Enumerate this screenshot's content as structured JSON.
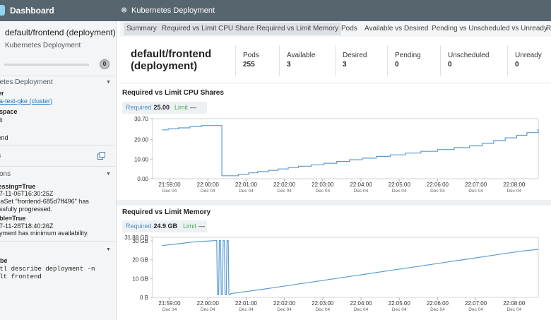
{
  "topbar": {
    "app_title": "Dashboard",
    "tab_icon": "cluster-gear-icon",
    "tab_title": "Kubernetes Deployment"
  },
  "left": {
    "title": "default/frontend (deployment)",
    "subtitle": "Kubernetes Deployment",
    "badge": "0",
    "sections": {
      "deployment": "netes Deployment",
      "details": "ls",
      "conditions": "tions",
      "cli": "l"
    },
    "cluster_key": "ter",
    "cluster_link": "na-test-gke (cluster)",
    "namespace_key": "espace",
    "namespace_val": "ult",
    "name_key": "e",
    "name_val": "tend",
    "cond1_key": "ressing=True",
    "cond1_time": "17-11-06T16:30:25Z",
    "cond1_msg1": "icaSet \"frontend-685d7ff496\" has",
    "cond1_msg2": "essfully progressed.",
    "cond2_key": "able=True",
    "cond2_time": "17-11-28T18:40:26Z",
    "cond2_msg": "oyment has minimum availability.",
    "cli_key": "ribe",
    "cli_line1": "ctl describe deployment -n",
    "cli_line2": "ult frontend"
  },
  "tabs": [
    {
      "label": "Summary",
      "active": true
    },
    {
      "label": "Required vs Limit CPU Shares",
      "active": true
    },
    {
      "label": "Required vs Limit Memory",
      "active": true
    },
    {
      "label": "Pods",
      "active": false
    },
    {
      "label": "Available vs Desired",
      "active": false
    },
    {
      "label": "Pending vs Unscheduled vs Unready",
      "active": false
    },
    {
      "label": "R",
      "active": false
    }
  ],
  "summary": {
    "title_line1": "default/frontend",
    "title_line2": "(deployment)",
    "stats": [
      {
        "label": "Pods",
        "value": "255"
      },
      {
        "label": "Available",
        "value": "3"
      },
      {
        "label": "Desired",
        "value": "3"
      },
      {
        "label": "Pending",
        "value": "0"
      },
      {
        "label": "Unscheduled",
        "value": "0"
      },
      {
        "label": "Unready",
        "value": "0"
      }
    ]
  },
  "colors": {
    "series": "#5b9bd0",
    "accent": "#4caf50",
    "topbar": "#57656f"
  },
  "chart_data": [
    {
      "type": "line",
      "title": "Required vs Limit CPU Shares",
      "legend": {
        "required_label": "Required",
        "required_value": "25.00",
        "limit_label": "Limit",
        "limit_value": "—"
      },
      "ylim": [
        0,
        30.7
      ],
      "yticks": [
        "30.70",
        "20.00",
        "10.00",
        "0.00"
      ],
      "xlim": [
        0,
        590
      ],
      "x_ticks": [
        {
          "t": 0,
          "time": "21:59:00",
          "date": "Dec 04"
        },
        {
          "t": 60,
          "time": "22:00:00",
          "date": "Dec 04"
        },
        {
          "t": 120,
          "time": "22:01:00",
          "date": "Dec 04"
        },
        {
          "t": 180,
          "time": "22:02:00",
          "date": "Dec 04"
        },
        {
          "t": 240,
          "time": "22:03:00",
          "date": "Dec 04"
        },
        {
          "t": 300,
          "time": "22:04:00",
          "date": "Dec 04"
        },
        {
          "t": 360,
          "time": "22:05:00",
          "date": "Dec 04"
        },
        {
          "t": 420,
          "time": "22:06:00",
          "date": "Dec 04"
        },
        {
          "t": 480,
          "time": "22:07:00",
          "date": "Dec 04"
        },
        {
          "t": 540,
          "time": "22:08:00",
          "date": "Dec 04"
        }
      ],
      "series": [
        {
          "step": true,
          "x": [
            -12,
            -2,
            14,
            32,
            50,
            81,
            82,
            87,
            108,
            124,
            138,
            155,
            170,
            186,
            202,
            222,
            242,
            262,
            282,
            302,
            324,
            346,
            370,
            394,
            420,
            446,
            470,
            490,
            508,
            526,
            544,
            560,
            578
          ],
          "y": [
            25,
            25.5,
            26,
            26.7,
            27.2,
            27.2,
            1.5,
            1.5,
            2.2,
            3,
            3.6,
            4.3,
            5,
            5.7,
            6.4,
            7.1,
            7.9,
            8.8,
            9.7,
            10.5,
            11.4,
            12.2,
            13.1,
            14,
            14.9,
            15.9,
            16.8,
            18.1,
            19.5,
            20.9,
            22.2,
            23.6,
            25
          ]
        }
      ]
    },
    {
      "type": "line",
      "title": "Required vs Limit Memory",
      "legend": {
        "required_label": "Required",
        "required_value": "24.9 GB",
        "limit_label": "Limit",
        "limit_value": "—"
      },
      "ylim": [
        0,
        31.88
      ],
      "yticks": [
        "31.88 GB",
        "30 GB",
        "20 GB",
        "10 GB",
        "0 B"
      ],
      "ytick_values": [
        31.88,
        30,
        20,
        10,
        0
      ],
      "xlim": [
        0,
        590
      ],
      "x_ticks": [
        {
          "t": 0,
          "time": "21:59:00",
          "date": "Dec 04"
        },
        {
          "t": 60,
          "time": "22:00:00",
          "date": "Dec 04"
        },
        {
          "t": 120,
          "time": "22:01:00",
          "date": "Dec 04"
        },
        {
          "t": 180,
          "time": "22:02:00",
          "date": "Dec 04"
        },
        {
          "t": 240,
          "time": "22:03:00",
          "date": "Dec 04"
        },
        {
          "t": 300,
          "time": "22:04:00",
          "date": "Dec 04"
        },
        {
          "t": 360,
          "time": "22:05:00",
          "date": "Dec 04"
        },
        {
          "t": 420,
          "time": "22:06:00",
          "date": "Dec 04"
        },
        {
          "t": 480,
          "time": "22:07:00",
          "date": "Dec 04"
        },
        {
          "t": 540,
          "time": "22:08:00",
          "date": "Dec 04"
        }
      ],
      "series": [
        {
          "step": false,
          "x": [
            -12,
            40,
            74,
            75,
            77,
            78,
            80,
            81,
            83,
            84,
            86,
            87,
            89,
            90,
            92,
            93,
            95,
            96,
            150,
            200,
            250,
            300,
            350,
            400,
            450,
            500,
            550,
            578
          ],
          "y": [
            27.5,
            29.5,
            30.2,
            1.5,
            1.5,
            30.2,
            30.2,
            1.5,
            1.5,
            30.2,
            30.2,
            1.5,
            1.5,
            30.2,
            30.2,
            1.5,
            1.5,
            2,
            4.5,
            7,
            9.5,
            12,
            14.5,
            17,
            19.5,
            22,
            24.5,
            25.5
          ]
        }
      ]
    }
  ]
}
